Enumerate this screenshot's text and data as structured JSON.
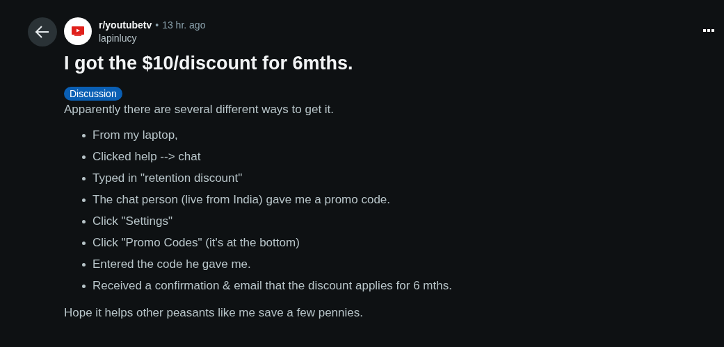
{
  "post": {
    "subreddit": "r/youtubetv",
    "separator": "•",
    "time": "13 hr. ago",
    "author": "lapinlucy",
    "title": "I got the $10/discount for 6mths.",
    "flair": "Discussion",
    "intro": "Apparently there are several different ways to get it.",
    "steps": [
      "From my laptop,",
      "Clicked help --> chat",
      "Typed in \"retention discount\"",
      "The chat person (live from India) gave me a promo code.",
      "Click \"Settings\"",
      "Click \"Promo Codes\" (it's at the bottom)",
      "Entered the code he gave me.",
      "Received a confirmation & email that the discount applies for 6 mths."
    ],
    "outro": "Hope it helps other peasants like me save a few pennies."
  }
}
